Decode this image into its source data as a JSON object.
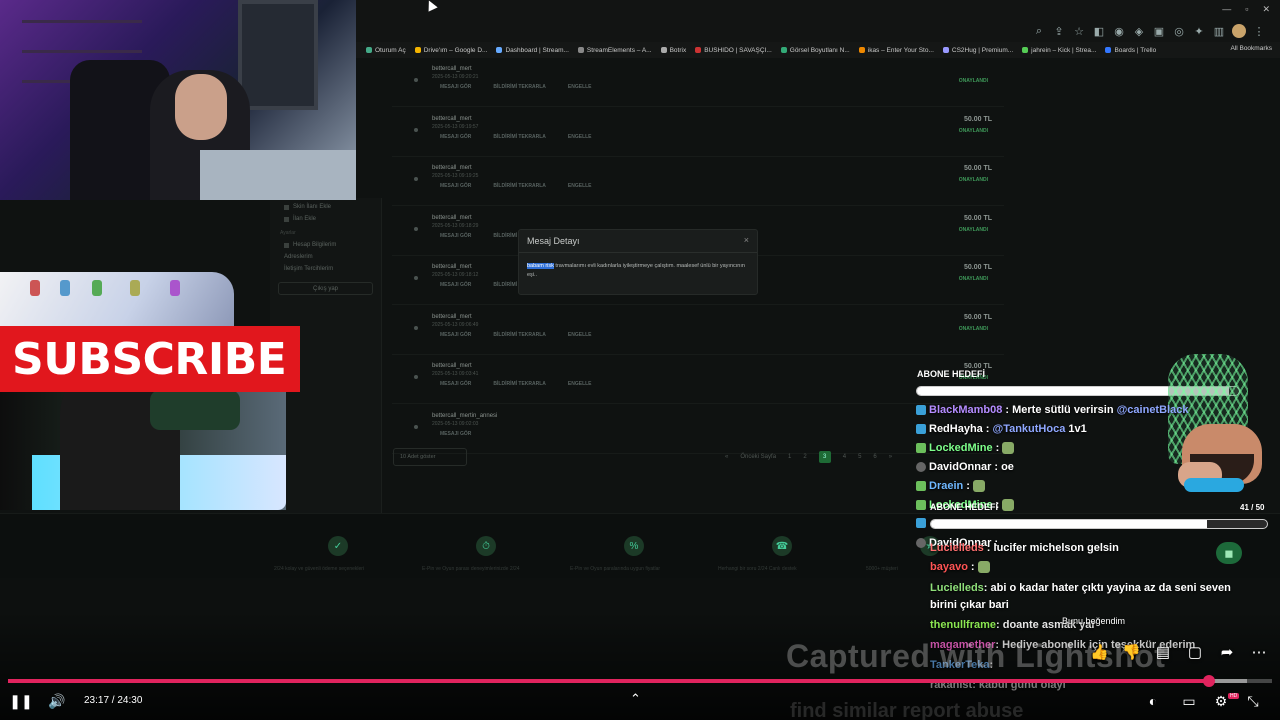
{
  "browser": {
    "bookmarks": [
      "Oturum Aç",
      "Drive'ım – Google D...",
      "Dashboard | Stream...",
      "StreamElements – A...",
      "Botrix",
      "BUSHIDO | SAVAŞÇI...",
      "Görsel Boyutlanı N...",
      "ikas – Enter Your Sto...",
      "CS2Hug | Premium...",
      "jahrein – Kick | Strea...",
      "Boards | Trello"
    ],
    "all_bookmarks": "All Bookmarks"
  },
  "dashboard": {
    "sidebar": {
      "items_top": [
        "Skin İlanı Ekle",
        "İlan Ekle"
      ],
      "section": "Ayarlar",
      "items": [
        "Hesap Bilgilerim",
        "Adreslerim",
        "İletişim Tercihlerim"
      ],
      "logout": "Çıkış yap"
    },
    "rows": [
      {
        "user": "bettercall_mert",
        "date": "2025-05-13 09:20:21",
        "amount": "",
        "status": "ONAYLANDI",
        "actions": [
          "MESAJI GÖR",
          "BİLDİRİMİ TEKRARLA",
          "ENGELLE"
        ]
      },
      {
        "user": "bettercall_mert",
        "date": "2025-05-13 09:19:57",
        "amount": "50.00 TL",
        "status": "ONAYLANDI",
        "actions": [
          "MESAJI GÖR",
          "BİLDİRİMİ TEKRARLA",
          "ENGELLE"
        ]
      },
      {
        "user": "bettercall_mert",
        "date": "2025-05-13 09:19:25",
        "amount": "50.00 TL",
        "status": "ONAYLANDI",
        "actions": [
          "MESAJI GÖR",
          "BİLDİRİMİ TEKRARLA",
          "ENGELLE"
        ]
      },
      {
        "user": "bettercall_mert",
        "date": "2025-05-13 09:18:29",
        "amount": "50.00 TL",
        "status": "ONAYLANDI",
        "actions": [
          "MESAJI GÖR",
          "BİLDİRİMİ TEKRARLA",
          "ENGELLE"
        ]
      },
      {
        "user": "bettercall_mert",
        "date": "2025-05-13 09:18:12",
        "amount": "50.00 TL",
        "status": "ONAYLANDI",
        "actions": [
          "MESAJI GÖR",
          "BİLDİRİMİ TEKRARLA",
          "ENGELLE"
        ]
      },
      {
        "user": "bettercall_mert",
        "date": "2025-05-13 09:06:49",
        "amount": "50.00 TL",
        "status": "ONAYLANDI",
        "actions": [
          "MESAJI GÖR",
          "BİLDİRİMİ TEKRARLA",
          "ENGELLE"
        ]
      },
      {
        "user": "bettercall_mert",
        "date": "2025-05-13 09:03:41",
        "amount": "50.00 TL",
        "status": "ONAYLANDI",
        "actions": [
          "MESAJI GÖR",
          "BİLDİRİMİ TEKRARLA",
          "ENGELLE"
        ]
      },
      {
        "user": "bettercall_mertin_annesi",
        "date": "2025-05-13 09:02:03",
        "amount": "",
        "status": "",
        "actions": [
          "MESAJI GÖR"
        ]
      }
    ],
    "page_size": "10 Adet göster",
    "pager": [
      "«",
      "Önceki Sayfa",
      "1",
      "2",
      "3",
      "4",
      "5",
      "6",
      "»"
    ],
    "pager_active": "3"
  },
  "modal": {
    "title": "Mesaj Detayı",
    "close": "×",
    "highlight": "babam risk",
    "body": " travmalarımı evli kadınlarla iyileştirmeye çalıştım. maalesef ünlü bir yayıncının eşi.."
  },
  "subscribe": "SUBSCRIBE",
  "overlay": {
    "goal1_label": "ABONE HEDEFİ",
    "goal2_label": "ABONE HEDEFİ",
    "goal2_count": "41 / 50",
    "goal1_progress": 0.97,
    "goal2_progress": 0.82,
    "chat": [
      {
        "badge": "sub",
        "name": "BlackMamb08",
        "color": "#b48cff",
        "msg": ": Merte sütlü verirsin ",
        "mention": "@cainetBlack"
      },
      {
        "badge": "sub",
        "name": "RedHayha",
        "color": "#ffffff",
        "msg": ": ",
        "mention": "@TankutHoca",
        "tail": " 1v1"
      },
      {
        "badge": "mod",
        "name": "LockedMine",
        "color": "#7dff8a",
        "msg": ":",
        "emoji": true
      },
      {
        "badge": "grey",
        "name": "DavidOnnar",
        "color": "#ffffff",
        "msg": ": oe"
      },
      {
        "badge": "mod",
        "name": "Draein",
        "color": "#6fb8ff",
        "msg": ":",
        "emoji": true
      },
      {
        "badge": "mod",
        "name": "LockedMine",
        "color": "#7dff8a",
        "msg": ":",
        "emoji": true
      },
      {
        "badge": "sub",
        "name": "",
        "color": "#ffffff",
        "msg": ""
      },
      {
        "badge": "grey",
        "name": "DavidOnnar",
        "color": "#ffffff",
        "msg": ":"
      },
      {
        "badge": "",
        "name": "Lucielleds",
        "color": "#ff6f6f",
        "msg": ": lucifer michelson gelsin"
      },
      {
        "badge": "",
        "name": "bayavo",
        "color": "#ff5555",
        "msg": ":",
        "emoji": true
      }
    ],
    "chat_wrap": [
      {
        "name": "Lucielleds",
        "color": "#8fe07a",
        "msg": ": abi o kadar hater çıktı yayina az da seni seven birini çıkar bari"
      },
      {
        "name": "thenullframe",
        "color": "#9aff5a",
        "msg": ": doante asmak yar"
      },
      {
        "name": "magamether",
        "color": "#ff6ad5",
        "msg": ": Hediye abonelik için teşekkür ederim"
      },
      {
        "name": "TankerTeka",
        "color": "#6fb8ff",
        "msg": ":"
      },
      {
        "name": "rakanist",
        "color": "#ffffff",
        "msg": ": kabul günü olayı"
      }
    ],
    "tooltip": "Bunu beğendim"
  },
  "watermark": {
    "title": "Captured with Lightshot",
    "links": "find similar    report abuse"
  },
  "player": {
    "time": "23:17 / 24:30",
    "played": 0.9503,
    "buffered": 0.98,
    "hd": "HD"
  },
  "features": [
    "2/24 kolay ve güvenli ödeme seçenekleri",
    "E-Pin ve Oyun parası deneyimlerinizde 2/24",
    "E-Pin ve Oyun paralarında uygun fiyatlar",
    "Herhangi bir soru 2/24 Canlı destek",
    "5000+ müşteri"
  ]
}
